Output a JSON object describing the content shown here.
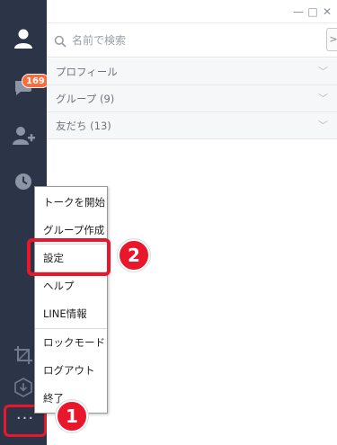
{
  "sidebar": {
    "icons": [
      "person-icon",
      "chat-icon",
      "add-friend-icon",
      "clock-icon",
      "crop-icon",
      "download-icon"
    ],
    "badge_count": "169",
    "more_label": "···"
  },
  "window": {
    "minimize": "—",
    "maximize": "□",
    "close": "✕"
  },
  "search": {
    "placeholder": "名前で検索",
    "toggle_label": ">"
  },
  "sections": [
    {
      "label": "プロフィール"
    },
    {
      "label": "グループ (9)"
    },
    {
      "label": "友だち (13)"
    }
  ],
  "menu": {
    "items": [
      {
        "label": "トークを開始"
      },
      {
        "label": "グループ作成"
      },
      {
        "label": "設定"
      },
      {
        "label": "ヘルプ"
      },
      {
        "label": "LINE情報"
      },
      {
        "label": "ロックモード"
      },
      {
        "label": "ログアウト"
      },
      {
        "label": "終了"
      }
    ]
  },
  "steps": {
    "one": "1",
    "two": "2"
  },
  "colors": {
    "sidebar_bg": "#2b3547",
    "highlight": "#e8172b",
    "badge": "#ff6a3a"
  }
}
